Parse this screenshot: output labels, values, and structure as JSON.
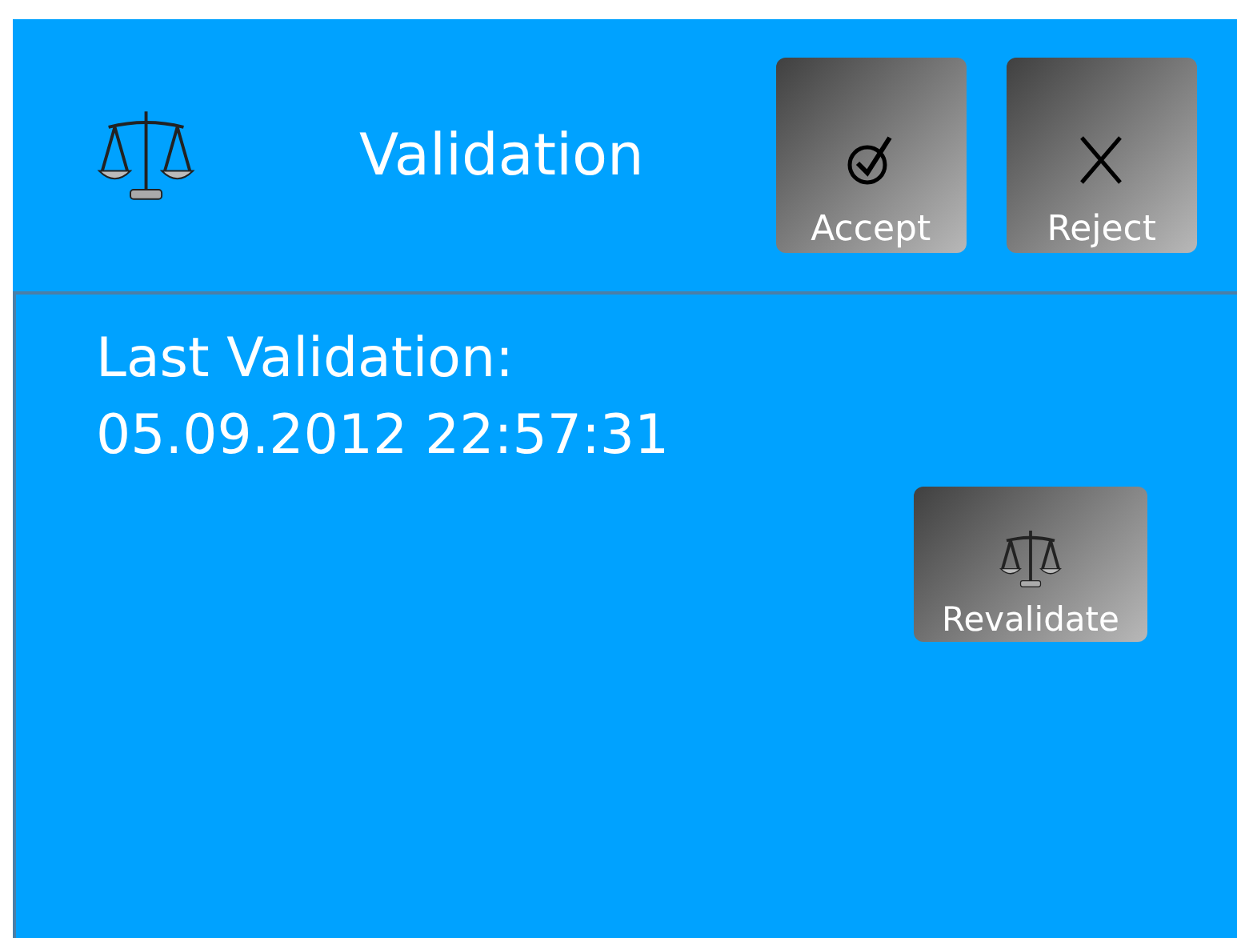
{
  "header": {
    "title": "Validation",
    "buttons": [
      {
        "kind": "accept",
        "label": "Accept"
      },
      {
        "kind": "reject",
        "label": "Reject"
      }
    ]
  },
  "content": {
    "label": "Last Validation:",
    "timestamp": "05.09.2012 22:57:31",
    "button": {
      "kind": "scales",
      "label": "Revalidate"
    }
  }
}
